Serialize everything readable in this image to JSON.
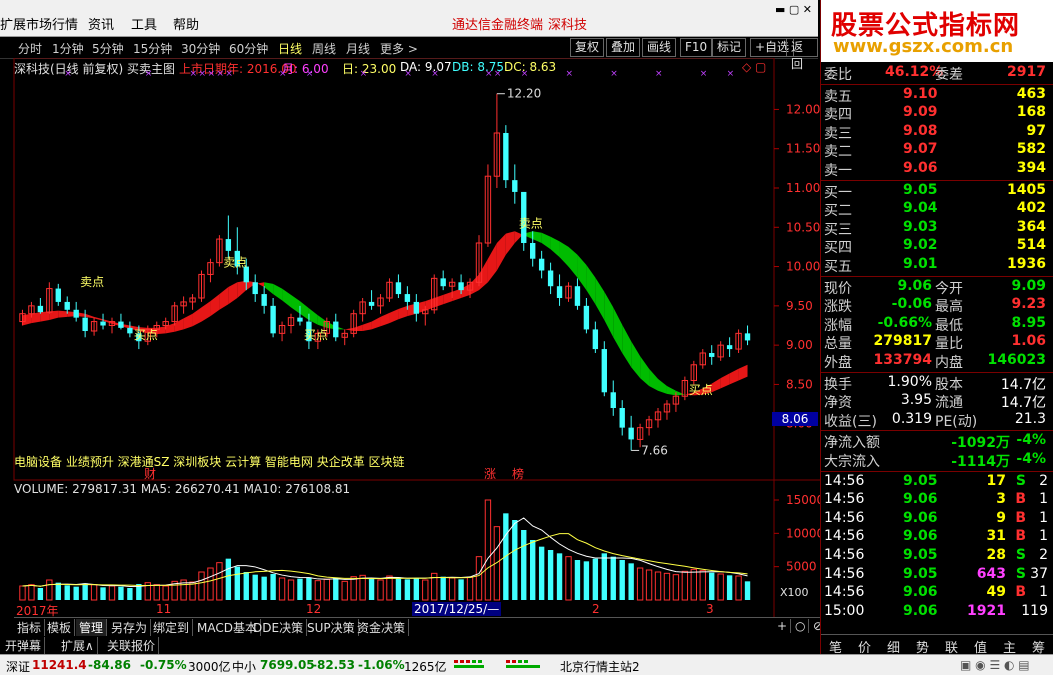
{
  "menu": {
    "items": [
      "扩展市场行情",
      "资讯",
      "工具",
      "帮助"
    ],
    "brand_link": "通达信金融终端",
    "stock_link": "深科技"
  },
  "periods": [
    "分时",
    "1分钟",
    "5分钟",
    "15分钟",
    "30分钟",
    "60分钟",
    "日线",
    "周线",
    "月线",
    "更多 >"
  ],
  "active_period": "日线",
  "toolbar": [
    "复权",
    "叠加",
    "画线",
    "F10",
    "标记",
    "+自选",
    "返回"
  ],
  "chart_head": {
    "title": "深科技(日线 前复权) 买卖主图",
    "listing": "上市日期年: 2016.00",
    "month": "月: 6.00",
    "day": "日: 23.00",
    "da": "DA: 9.07",
    "db": "DB: 8.75",
    "dc": "DC: 8.63"
  },
  "price_axis": [
    "12.00",
    "11.50",
    "11.00",
    "10.50",
    "10.00",
    "9.50",
    "9.00",
    "8.50",
    "8.00"
  ],
  "price_marker": "8.06",
  "annotations": {
    "high": "12.20",
    "low": "7.66",
    "sell": "卖点",
    "buy": "买点"
  },
  "tags": "电脑设备 业绩预升 深港通SZ 深圳板块 云计算 智能电网 央企改革 区块链",
  "markers": {
    "cai": "财",
    "zhang": "涨",
    "bang": "榜"
  },
  "volume_head": "VOLUME: 279817.31  MA5: 266270.41  MA10: 276108.81",
  "volume_axis": [
    "15000",
    "10000",
    "5000"
  ],
  "volume_unit": "X100",
  "time_axis": [
    "2017年",
    "11",
    "12",
    "2017/12/25/—",
    "2",
    "3"
  ],
  "bottom_tabs": [
    "指标",
    "模板",
    "管理",
    "另存为",
    "绑定到",
    "MACD基本",
    "DDE决策",
    "SUP决策",
    "资金决策"
  ],
  "bottom_icons": [
    "+",
    "○",
    "⊘"
  ],
  "sub_tabs": [
    "开弹幕",
    "扩展∧",
    "关联报价"
  ],
  "ad": {
    "title": "股票公式指标网",
    "url": "www.gszx.com.cn"
  },
  "quote": {
    "weibi_label": "委比",
    "weibi": "46.12%",
    "weicha_label": "委差",
    "weicha": "2917",
    "asks": [
      {
        "label": "卖五",
        "price": "9.10",
        "vol": "463"
      },
      {
        "label": "卖四",
        "price": "9.09",
        "vol": "168"
      },
      {
        "label": "卖三",
        "price": "9.08",
        "vol": "97"
      },
      {
        "label": "卖二",
        "price": "9.07",
        "vol": "582"
      },
      {
        "label": "卖一",
        "price": "9.06",
        "vol": "394"
      }
    ],
    "bids": [
      {
        "label": "买一",
        "price": "9.05",
        "vol": "1405"
      },
      {
        "label": "买二",
        "price": "9.04",
        "vol": "402"
      },
      {
        "label": "买三",
        "price": "9.03",
        "vol": "364"
      },
      {
        "label": "买四",
        "price": "9.02",
        "vol": "514"
      },
      {
        "label": "买五",
        "price": "9.01",
        "vol": "1936"
      }
    ],
    "stats": [
      {
        "l1": "现价",
        "v1": "9.06",
        "c1": "g",
        "l2": "今开",
        "v2": "9.09",
        "c2": "g"
      },
      {
        "l1": "涨跌",
        "v1": "-0.06",
        "c1": "g",
        "l2": "最高",
        "v2": "9.23",
        "c2": "r"
      },
      {
        "l1": "涨幅",
        "v1": "-0.66%",
        "c1": "g",
        "l2": "最低",
        "v2": "8.95",
        "c2": "g"
      },
      {
        "l1": "总量",
        "v1": "279817",
        "c1": "y",
        "l2": "量比",
        "v2": "1.06",
        "c2": "r"
      },
      {
        "l1": "外盘",
        "v1": "133794",
        "c1": "r",
        "l2": "内盘",
        "v2": "146023",
        "c2": "g"
      }
    ],
    "info": [
      {
        "l1": "换手",
        "v1": "1.90%",
        "l2": "股本",
        "v2": "14.7亿"
      },
      {
        "l1": "净资",
        "v1": "3.95",
        "l2": "流通",
        "v2": "14.7亿"
      },
      {
        "l1": "收益(三)",
        "v1": "0.319",
        "l2": "PE(动)",
        "v2": "21.3"
      }
    ],
    "flow": [
      {
        "label": "净流入额",
        "v1": "-1092万",
        "v2": "-4%"
      },
      {
        "label": "大宗流入",
        "v1": "-1114万",
        "v2": "-4%"
      }
    ],
    "ticks": [
      {
        "t": "14:56",
        "p": "9.05",
        "v": "17",
        "d": "S",
        "n": "2",
        "vc": "y"
      },
      {
        "t": "14:56",
        "p": "9.06",
        "v": "3",
        "d": "B",
        "n": "1",
        "vc": "y"
      },
      {
        "t": "14:56",
        "p": "9.06",
        "v": "9",
        "d": "B",
        "n": "1",
        "vc": "y"
      },
      {
        "t": "14:56",
        "p": "9.06",
        "v": "31",
        "d": "B",
        "n": "1",
        "vc": "y"
      },
      {
        "t": "14:56",
        "p": "9.05",
        "v": "28",
        "d": "S",
        "n": "2",
        "vc": "y"
      },
      {
        "t": "14:56",
        "p": "9.05",
        "v": "643",
        "d": "S",
        "n": "37",
        "vc": "m"
      },
      {
        "t": "14:56",
        "p": "9.06",
        "v": "49",
        "d": "B",
        "n": "1",
        "vc": "y"
      },
      {
        "t": "15:00",
        "p": "9.06",
        "v": "1921",
        "d": "",
        "n": "119",
        "vc": "m"
      }
    ],
    "tabs": [
      "笔",
      "价",
      "细",
      "势",
      "联",
      "值",
      "主",
      "筹"
    ]
  },
  "status": {
    "sz_label": "深证",
    "sz": "11241.4",
    "sz_chg": "-84.86",
    "sz_pct": "-0.75%",
    "sz_amt": "3000亿",
    "zx_label": "中小",
    "zx": "7699.05",
    "zx_chg": "-82.53",
    "zx_pct": "-1.06%",
    "zx_amt": "1265亿",
    "server": "北京行情主站2"
  },
  "chart_data": {
    "type": "candlestick",
    "yrange": [
      7.5,
      12.4
    ],
    "candles": [
      [
        9.3,
        9.45,
        9.25,
        9.4
      ],
      [
        9.4,
        9.55,
        9.35,
        9.5
      ],
      [
        9.5,
        9.6,
        9.4,
        9.42
      ],
      [
        9.42,
        9.8,
        9.4,
        9.72
      ],
      [
        9.72,
        9.78,
        9.5,
        9.55
      ],
      [
        9.55,
        9.62,
        9.4,
        9.45
      ],
      [
        9.45,
        9.55,
        9.3,
        9.35
      ],
      [
        9.35,
        9.45,
        9.1,
        9.18
      ],
      [
        9.18,
        9.35,
        9.12,
        9.3
      ],
      [
        9.3,
        9.4,
        9.2,
        9.25
      ],
      [
        9.25,
        9.35,
        9.15,
        9.3
      ],
      [
        9.3,
        9.4,
        9.2,
        9.22
      ],
      [
        9.22,
        9.3,
        9.1,
        9.15
      ],
      [
        9.15,
        9.25,
        8.95,
        9.05
      ],
      [
        9.05,
        9.25,
        9.0,
        9.2
      ],
      [
        9.2,
        9.3,
        9.1,
        9.25
      ],
      [
        9.25,
        9.35,
        9.2,
        9.3
      ],
      [
        9.3,
        9.55,
        9.25,
        9.5
      ],
      [
        9.5,
        9.62,
        9.4,
        9.55
      ],
      [
        9.55,
        9.65,
        9.45,
        9.6
      ],
      [
        9.6,
        9.95,
        9.55,
        9.9
      ],
      [
        9.9,
        10.1,
        9.8,
        10.05
      ],
      [
        10.05,
        10.4,
        10.0,
        10.35
      ],
      [
        10.35,
        10.65,
        10.1,
        10.2
      ],
      [
        10.2,
        10.5,
        9.9,
        10.0
      ],
      [
        10.0,
        10.1,
        9.7,
        9.8
      ],
      [
        9.8,
        9.9,
        9.55,
        9.65
      ],
      [
        9.65,
        9.75,
        9.4,
        9.5
      ],
      [
        9.5,
        9.6,
        9.1,
        9.15
      ],
      [
        9.15,
        9.3,
        9.05,
        9.25
      ],
      [
        9.25,
        9.4,
        9.15,
        9.35
      ],
      [
        9.35,
        9.5,
        9.25,
        9.3
      ],
      [
        9.3,
        9.4,
        8.95,
        9.05
      ],
      [
        9.05,
        9.2,
        8.95,
        9.15
      ],
      [
        9.15,
        9.35,
        9.1,
        9.3
      ],
      [
        9.3,
        9.4,
        9.05,
        9.1
      ],
      [
        9.1,
        9.2,
        9.0,
        9.15
      ],
      [
        9.15,
        9.45,
        9.1,
        9.4
      ],
      [
        9.4,
        9.6,
        9.3,
        9.55
      ],
      [
        9.55,
        9.7,
        9.45,
        9.5
      ],
      [
        9.5,
        9.65,
        9.4,
        9.6
      ],
      [
        9.6,
        9.85,
        9.55,
        9.8
      ],
      [
        9.8,
        9.9,
        9.6,
        9.65
      ],
      [
        9.65,
        9.75,
        9.45,
        9.55
      ],
      [
        9.55,
        9.65,
        9.3,
        9.4
      ],
      [
        9.4,
        9.5,
        9.25,
        9.45
      ],
      [
        9.45,
        9.9,
        9.4,
        9.85
      ],
      [
        9.85,
        9.95,
        9.7,
        9.75
      ],
      [
        9.75,
        9.85,
        9.6,
        9.8
      ],
      [
        9.8,
        9.9,
        9.65,
        9.7
      ],
      [
        9.7,
        9.85,
        9.6,
        9.8
      ],
      [
        9.8,
        10.4,
        9.75,
        10.3
      ],
      [
        10.3,
        11.3,
        10.25,
        11.15
      ],
      [
        11.15,
        12.2,
        11.0,
        11.7
      ],
      [
        11.7,
        11.8,
        11.0,
        11.1
      ],
      [
        11.1,
        11.3,
        10.8,
        10.95
      ],
      [
        10.95,
        10.6,
        10.2,
        10.3
      ],
      [
        10.3,
        10.45,
        10.0,
        10.1
      ],
      [
        10.1,
        10.2,
        9.85,
        9.95
      ],
      [
        9.95,
        10.05,
        9.65,
        9.75
      ],
      [
        9.75,
        9.9,
        9.5,
        9.6
      ],
      [
        9.6,
        9.8,
        9.55,
        9.75
      ],
      [
        9.75,
        9.85,
        9.45,
        9.5
      ],
      [
        9.5,
        9.6,
        9.15,
        9.2
      ],
      [
        9.2,
        9.3,
        8.9,
        8.95
      ],
      [
        8.95,
        9.05,
        8.35,
        8.4
      ],
      [
        8.4,
        8.55,
        8.1,
        8.2
      ],
      [
        8.2,
        8.3,
        7.85,
        7.95
      ],
      [
        7.95,
        8.1,
        7.66,
        7.8
      ],
      [
        7.8,
        8.0,
        7.7,
        7.95
      ],
      [
        7.95,
        8.1,
        7.85,
        8.05
      ],
      [
        8.05,
        8.2,
        7.95,
        8.15
      ],
      [
        8.15,
        8.3,
        8.05,
        8.25
      ],
      [
        8.25,
        8.4,
        8.15,
        8.35
      ],
      [
        8.35,
        8.6,
        8.3,
        8.55
      ],
      [
        8.55,
        8.8,
        8.5,
        8.75
      ],
      [
        8.75,
        8.95,
        8.7,
        8.9
      ],
      [
        8.9,
        9.0,
        8.75,
        8.85
      ],
      [
        8.85,
        9.05,
        8.8,
        9.0
      ],
      [
        9.0,
        9.1,
        8.85,
        8.95
      ],
      [
        8.95,
        9.2,
        8.9,
        9.15
      ],
      [
        9.15,
        9.25,
        9.0,
        9.06
      ]
    ],
    "volumes": [
      2100,
      2300,
      1800,
      3000,
      2600,
      2200,
      2000,
      2500,
      2300,
      1900,
      2100,
      2000,
      1800,
      2400,
      2600,
      2300,
      2100,
      2800,
      3000,
      2700,
      4200,
      4800,
      5600,
      6200,
      5000,
      4200,
      3800,
      3500,
      3900,
      3300,
      3000,
      3200,
      3400,
      2900,
      3100,
      3300,
      2800,
      3500,
      3700,
      3200,
      3000,
      3600,
      3400,
      3100,
      3300,
      3000,
      4000,
      3500,
      3300,
      3100,
      3400,
      6500,
      15000,
      11000,
      13000,
      12000,
      10500,
      9000,
      8000,
      7500,
      7000,
      6500,
      6000,
      5800,
      6200,
      7000,
      6500,
      6000,
      5500,
      4800,
      4500,
      4200,
      4000,
      3800,
      4300,
      4600,
      4400,
      4100,
      3900,
      3700,
      3600,
      2800
    ],
    "cloud": [
      [
        9.38,
        9.25
      ],
      [
        9.4,
        9.28
      ],
      [
        9.42,
        9.3
      ],
      [
        9.43,
        9.32
      ],
      [
        9.44,
        9.35
      ],
      [
        9.43,
        9.36
      ],
      [
        9.42,
        9.37
      ],
      [
        9.4,
        9.36
      ],
      [
        9.36,
        9.34
      ],
      [
        9.33,
        9.31
      ],
      [
        9.3,
        9.27
      ],
      [
        9.27,
        9.24
      ],
      [
        9.25,
        9.21
      ],
      [
        9.23,
        9.18
      ],
      [
        9.22,
        9.15
      ],
      [
        9.22,
        9.14
      ],
      [
        9.24,
        9.15
      ],
      [
        9.28,
        9.17
      ],
      [
        9.34,
        9.2
      ],
      [
        9.4,
        9.24
      ],
      [
        9.48,
        9.3
      ],
      [
        9.56,
        9.37
      ],
      [
        9.65,
        9.45
      ],
      [
        9.74,
        9.52
      ],
      [
        9.8,
        9.6
      ],
      [
        9.82,
        9.7
      ],
      [
        9.8,
        9.78
      ],
      [
        9.74,
        9.8
      ],
      [
        9.65,
        9.78
      ],
      [
        9.57,
        9.72
      ],
      [
        9.48,
        9.64
      ],
      [
        9.4,
        9.56
      ],
      [
        9.32,
        9.47
      ],
      [
        9.26,
        9.38
      ],
      [
        9.22,
        9.3
      ],
      [
        9.2,
        9.24
      ],
      [
        9.2,
        9.2
      ],
      [
        9.22,
        9.18
      ],
      [
        9.26,
        9.18
      ],
      [
        9.3,
        9.2
      ],
      [
        9.36,
        9.24
      ],
      [
        9.41,
        9.28
      ],
      [
        9.46,
        9.33
      ],
      [
        9.5,
        9.37
      ],
      [
        9.53,
        9.4
      ],
      [
        9.56,
        9.44
      ],
      [
        9.6,
        9.48
      ],
      [
        9.64,
        9.52
      ],
      [
        9.68,
        9.56
      ],
      [
        9.72,
        9.6
      ],
      [
        9.78,
        9.64
      ],
      [
        9.9,
        9.7
      ],
      [
        10.1,
        9.8
      ],
      [
        10.3,
        9.95
      ],
      [
        10.42,
        10.15
      ],
      [
        10.45,
        10.3
      ],
      [
        10.4,
        10.42
      ],
      [
        10.35,
        10.45
      ],
      [
        10.3,
        10.43
      ],
      [
        10.22,
        10.38
      ],
      [
        10.12,
        10.32
      ],
      [
        10.0,
        10.25
      ],
      [
        9.86,
        10.15
      ],
      [
        9.7,
        10.02
      ],
      [
        9.52,
        9.86
      ],
      [
        9.32,
        9.68
      ],
      [
        9.1,
        9.48
      ],
      [
        8.9,
        9.26
      ],
      [
        8.72,
        9.05
      ],
      [
        8.58,
        8.86
      ],
      [
        8.48,
        8.7
      ],
      [
        8.42,
        8.57
      ],
      [
        8.38,
        8.48
      ],
      [
        8.36,
        8.42
      ],
      [
        8.37,
        8.37
      ],
      [
        8.4,
        8.36
      ],
      [
        8.45,
        8.37
      ],
      [
        8.51,
        8.4
      ],
      [
        8.58,
        8.45
      ],
      [
        8.64,
        8.5
      ],
      [
        8.7,
        8.55
      ],
      [
        8.75,
        8.6
      ]
    ]
  }
}
